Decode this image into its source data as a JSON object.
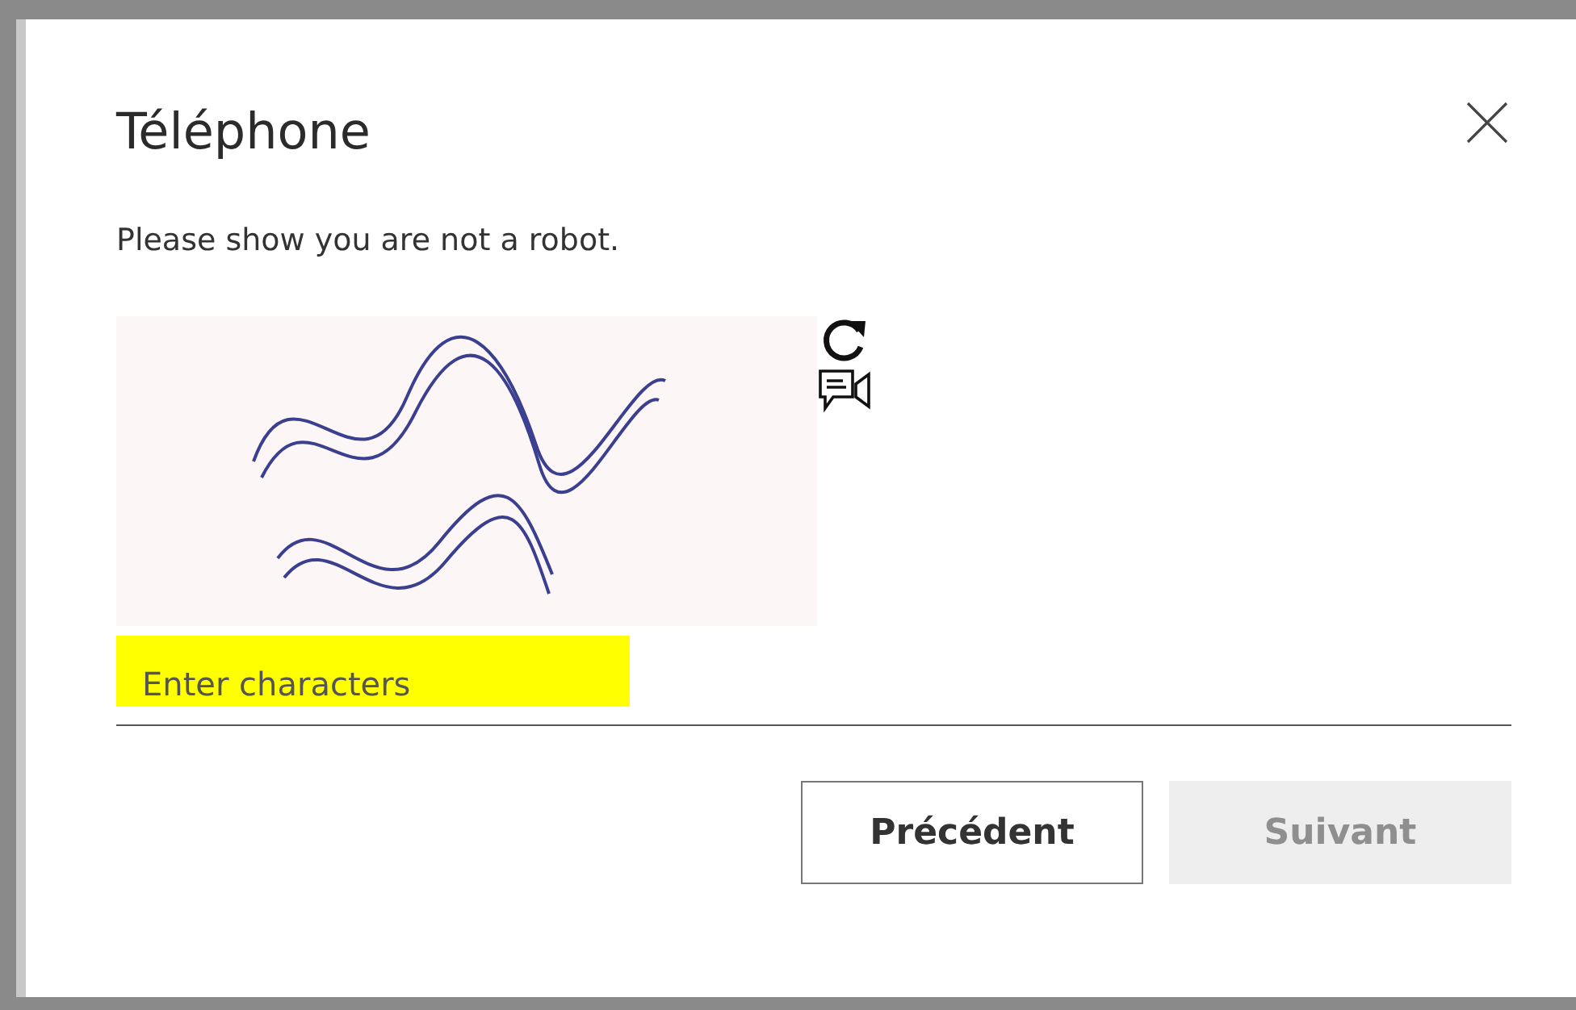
{
  "dialog": {
    "title": "Téléphone",
    "message": "Please show you are not a robot."
  },
  "input": {
    "placeholder": "Enter characters",
    "highlighted": true
  },
  "buttons": [
    {
      "label": "Précédent",
      "disabled": false
    },
    {
      "label": "Suivant",
      "disabled": true
    }
  ]
}
